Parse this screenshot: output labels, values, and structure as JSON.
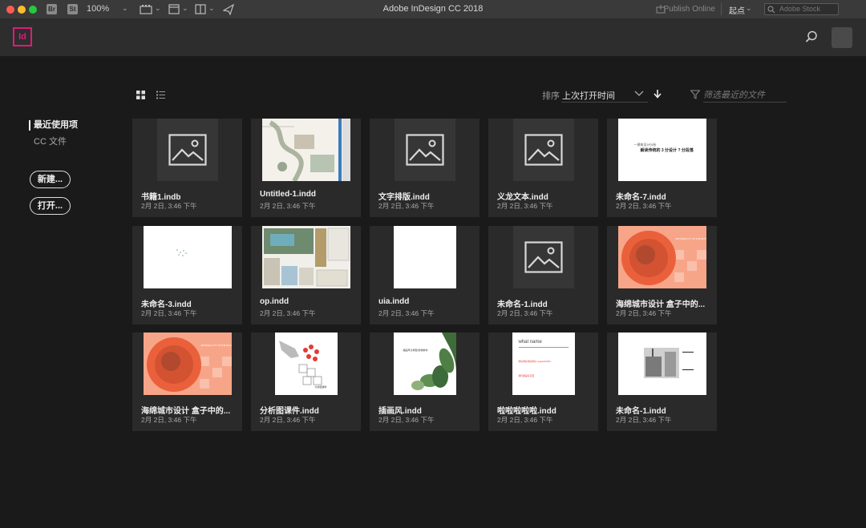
{
  "titlebar": {
    "title": "Adobe InDesign CC 2018",
    "bridge_badge": "Br",
    "stock_badge": "St",
    "zoom": "100%",
    "publish": "Publish Online",
    "workspace": "起点",
    "stock_placeholder": "Adobe Stock"
  },
  "app": {
    "logo": "Id"
  },
  "toolbar": {
    "sort_label": "排序",
    "sort_value": "上次打开时间",
    "filter_placeholder": "筛选最近的文件"
  },
  "sidebar": {
    "recent": "最近使用项",
    "cc_files": "CC 文件",
    "new_button": "新建...",
    "open_button": "打开..."
  },
  "files": [
    {
      "name": "书籍1.indb",
      "date": "2月 2日, 3:46 下午",
      "thumb": "placeholder"
    },
    {
      "name": "Untitled-1.indd",
      "date": "2月 2日, 3:46 下午",
      "thumb": "map"
    },
    {
      "name": "文字排版.indd",
      "date": "2月 2日, 3:46 下午",
      "thumb": "placeholder"
    },
    {
      "name": "义龙文本.indd",
      "date": "2月 2日, 3:46 下午",
      "thumb": "placeholder"
    },
    {
      "name": "未命名-7.indd",
      "date": "2月 2日, 3:46 下午",
      "thumb": "textpage",
      "thumb_text_small": "一建筑设计分析",
      "thumb_text_main": "解读传统的 3 分设计 ?  分段落"
    },
    {
      "name": "未命名-3.indd",
      "date": "2月 2日, 3:46 下午",
      "thumb": "whiteDots"
    },
    {
      "name": "op.indd",
      "date": "2月 2日, 3:46 下午",
      "thumb": "collage"
    },
    {
      "name": "uia.indd",
      "date": "2月 2日, 3:46 下午",
      "thumb": "blank"
    },
    {
      "name": "未命名-1.indd",
      "date": "2月 2日, 3:46 下午",
      "thumb": "placeholder"
    },
    {
      "name": "海绵城市设计 盒子中的...",
      "date": "2月 2日, 3:46 下午",
      "thumb": "orange",
      "thumb_caption": "SPONGE CITY IN THE BOX"
    },
    {
      "name": "海绵城市设计 盒子中的...",
      "date": "2月 2日, 3:46 下午",
      "thumb": "orange",
      "thumb_caption": "SPONGE CITY IN THE BOX"
    },
    {
      "name": "分析图课件.indd",
      "date": "2月 2日, 3:46 下午",
      "thumb": "hand",
      "thumb_caption": "分析图课件"
    },
    {
      "name": "插画风.indd",
      "date": "2月 2日, 3:46 下午",
      "thumb": "plants",
      "thumb_caption": "插画风分析图 植物素材"
    },
    {
      "name": "啦啦啦啦啦.indd",
      "date": "2月 2日, 3:46 下午",
      "thumb": "whatname",
      "thumb_title": "what name",
      "thumb_line1": "你好你好你好你好, angela12344",
      "thumb_line2": "我们都是好东西"
    },
    {
      "name": "未命名-1.indd",
      "date": "2月 2日, 3:46 下午",
      "thumb": "street"
    }
  ],
  "colors": {
    "accent_indesign": "#e3197a",
    "orange": "#f26d4f"
  }
}
